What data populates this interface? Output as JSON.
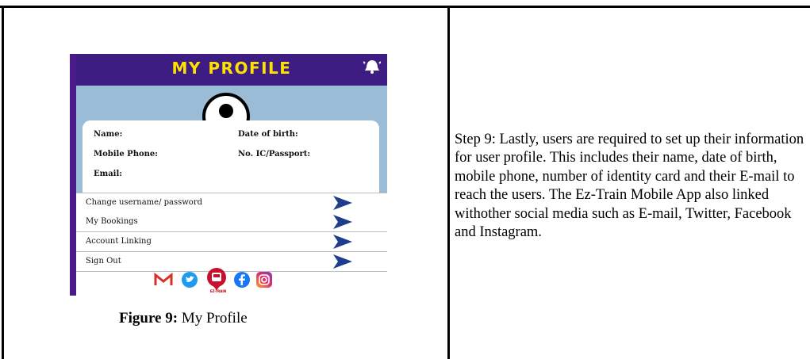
{
  "app": {
    "title": "MY PROFILE",
    "fields": [
      "Name:",
      "Date of birth:",
      "Mobile Phone:",
      "No. IC/Passport:",
      "Email:"
    ],
    "menu": [
      "Change username/ password",
      "My Bookings",
      "Account Linking",
      "Sign Out"
    ],
    "logo_text": "EZ-TRAIN",
    "social_icons": [
      "gmail-icon",
      "twitter-icon",
      "ez-train-logo",
      "facebook-icon",
      "instagram-icon"
    ],
    "colors": {
      "header": "#3d1d82",
      "title": "#ffe100",
      "profile_bg": "#9bbcd6",
      "arrow": "#1e3d8c"
    }
  },
  "caption": {
    "bold": "Figure 9:",
    "text": " My Profile"
  },
  "description": "Step 9: Lastly, users are required to set up their information for user  profile. This includes their name, date of birth, mobile phone, number of identity card and their E-mail to reach the users. The Ez-Train Mobile App also linked withother social media such as E-mail, Twitter, Facebook and Instagram."
}
